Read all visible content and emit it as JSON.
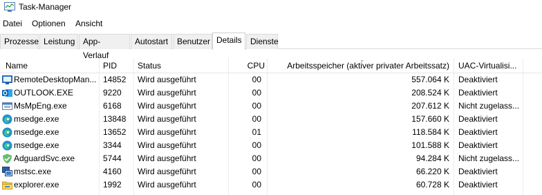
{
  "window": {
    "title": "Task-Manager"
  },
  "menu": [
    "Datei",
    "Optionen",
    "Ansicht"
  ],
  "tabs": [
    "Prozesse",
    "Leistung",
    "App-Verlauf",
    "Autostart",
    "Benutzer",
    "Details",
    "Dienste"
  ],
  "active_tab": "Details",
  "columns": {
    "name": "Name",
    "pid": "PID",
    "status": "Status",
    "cpu": "CPU",
    "memory": "Arbeitsspeicher (aktiver privater Arbeitssatz)",
    "uac": "UAC-Virtualisi..."
  },
  "rows": [
    {
      "icon": "remote-desktop-icon",
      "name": "RemoteDesktopMan...",
      "pid": "14852",
      "status": "Wird ausgeführt",
      "cpu": "00",
      "memory": "557.064 K",
      "uac": "Deaktiviert"
    },
    {
      "icon": "outlook-icon",
      "name": "OUTLOOK.EXE",
      "pid": "9220",
      "status": "Wird ausgeführt",
      "cpu": "00",
      "memory": "208.524 K",
      "uac": "Deaktiviert"
    },
    {
      "icon": "defender-icon",
      "name": "MsMpEng.exe",
      "pid": "6168",
      "status": "Wird ausgeführt",
      "cpu": "00",
      "memory": "207.612 K",
      "uac": "Nicht zugelass..."
    },
    {
      "icon": "edge-icon",
      "name": "msedge.exe",
      "pid": "13848",
      "status": "Wird ausgeführt",
      "cpu": "00",
      "memory": "157.660 K",
      "uac": "Deaktiviert"
    },
    {
      "icon": "edge-icon",
      "name": "msedge.exe",
      "pid": "13652",
      "status": "Wird ausgeführt",
      "cpu": "01",
      "memory": "118.584 K",
      "uac": "Deaktiviert"
    },
    {
      "icon": "edge-icon",
      "name": "msedge.exe",
      "pid": "3344",
      "status": "Wird ausgeführt",
      "cpu": "00",
      "memory": "101.588 K",
      "uac": "Deaktiviert"
    },
    {
      "icon": "adguard-icon",
      "name": "AdguardSvc.exe",
      "pid": "5744",
      "status": "Wird ausgeführt",
      "cpu": "00",
      "memory": "94.284 K",
      "uac": "Nicht zugelass..."
    },
    {
      "icon": "mstsc-icon",
      "name": "mstsc.exe",
      "pid": "4160",
      "status": "Wird ausgeführt",
      "cpu": "00",
      "memory": "66.220 K",
      "uac": "Deaktiviert"
    },
    {
      "icon": "explorer-icon",
      "name": "explorer.exe",
      "pid": "1992",
      "status": "Wird ausgeführt",
      "cpu": "00",
      "memory": "60.728 K",
      "uac": "Deaktiviert"
    }
  ]
}
